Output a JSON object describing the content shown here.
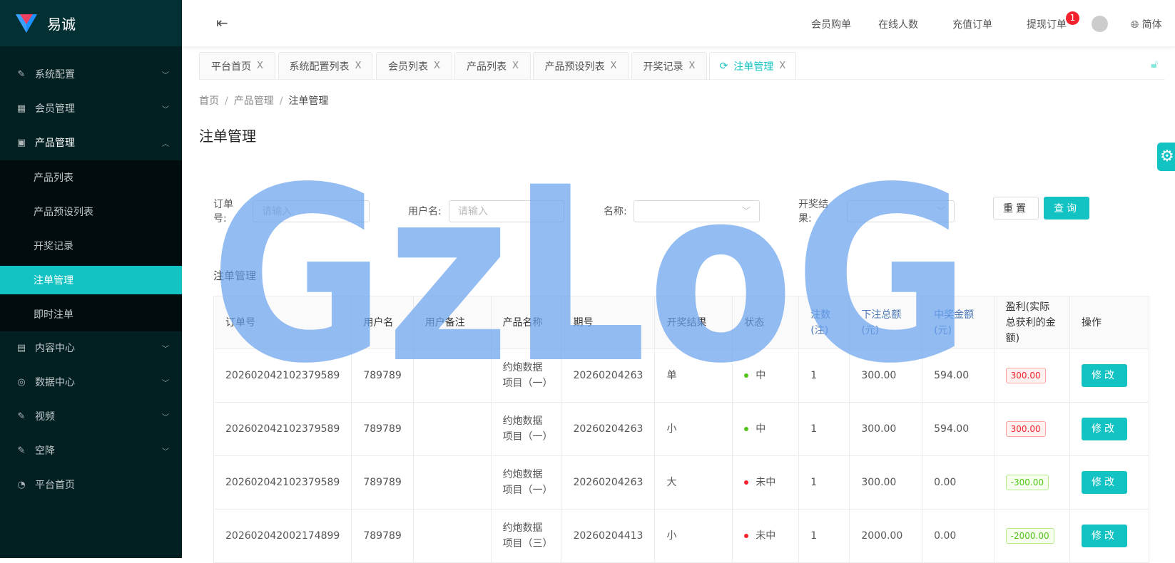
{
  "app": {
    "name": "易诚"
  },
  "sidebar": {
    "items": [
      {
        "label": "系统配置",
        "icon": "edit-icon"
      },
      {
        "label": "会员管理",
        "icon": "table-icon"
      },
      {
        "label": "产品管理",
        "icon": "appstore-icon"
      },
      {
        "label": "内容中心",
        "icon": "container-icon"
      },
      {
        "label": "数据中心",
        "icon": "check-circle-icon"
      },
      {
        "label": "视频",
        "icon": "edit-icon"
      },
      {
        "label": "空降",
        "icon": "edit-icon"
      },
      {
        "label": "平台首页",
        "icon": "dashboard-icon"
      }
    ],
    "subitems": [
      "产品列表",
      "产品预设列表",
      "开奖记录",
      "注单管理",
      "即时注单"
    ]
  },
  "header": {
    "links": [
      "会员购单",
      "在线人数",
      "充值订单",
      "提现订单"
    ],
    "badge": "1",
    "lang": "简体"
  },
  "tabs": [
    "平台首页",
    "系统配置列表",
    "会员列表",
    "产品列表",
    "产品预设列表",
    "开奖记录",
    "注单管理"
  ],
  "breadcrumb": [
    "首页",
    "产品管理",
    "注单管理"
  ],
  "page_title": "注单管理",
  "filters": {
    "order_label": "订单号:",
    "order_placeholder": "请输入",
    "user_label": "用户名:",
    "user_placeholder": "请输入",
    "name_label": "名称:",
    "result_label": "开奖结果:",
    "reset": "重置",
    "search": "查询"
  },
  "table": {
    "title": "注单管理",
    "columns": [
      "订单号",
      "用户名",
      "用户备注",
      "产品名称",
      "期号",
      "开奖结果",
      "状态",
      "注数(注)",
      "下注总额(元)",
      "中奖金额(元)",
      "盈利(实际总获利的金额)",
      "操作"
    ],
    "rows": [
      {
        "order": "202602042102379589",
        "user": "789789",
        "remark": "",
        "product": "约炮数据项目（一）",
        "period": "20260204263",
        "result": "单",
        "status": "中",
        "count": "1",
        "bet": "300.00",
        "win": "594.00",
        "profit": "300.00"
      },
      {
        "order": "202602042102379589",
        "user": "789789",
        "remark": "",
        "product": "约炮数据项目（一）",
        "period": "20260204263",
        "result": "小",
        "status": "中",
        "count": "1",
        "bet": "300.00",
        "win": "594.00",
        "profit": "300.00"
      },
      {
        "order": "202602042102379589",
        "user": "789789",
        "remark": "",
        "product": "约炮数据项目（一）",
        "period": "20260204263",
        "result": "大",
        "status": "未中",
        "count": "1",
        "bet": "300.00",
        "win": "0.00",
        "profit": "-300.00"
      },
      {
        "order": "202602042002174899",
        "user": "789789",
        "remark": "",
        "product": "约炮数据项目（三）",
        "period": "20260204413",
        "result": "小",
        "status": "未中",
        "count": "1",
        "bet": "2000.00",
        "win": "0.00",
        "profit": "-2000.00"
      }
    ],
    "edit_label": "修改"
  },
  "watermark": "GzLoG",
  "colors": {
    "accent": "#13c2c2",
    "win": "#52c41a",
    "lose": "#f5222d"
  }
}
